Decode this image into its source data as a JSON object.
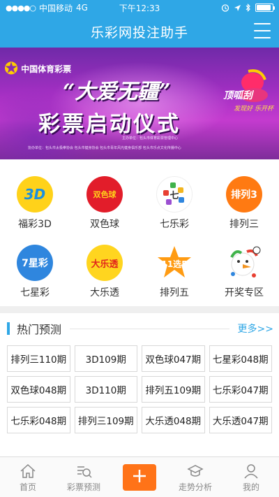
{
  "status_bar": {
    "carrier": "中国移动",
    "network": "4G",
    "time": "下午12:33",
    "battery_level": 0.9
  },
  "header": {
    "title": "乐彩网投注助手"
  },
  "banner": {
    "logo_text": "中国体育彩票",
    "slogan": "“大爱无疆”",
    "headline": "彩票启动仪式",
    "badge_text": "顶呱刮",
    "badge_sub": "发现好  乐开杯",
    "fine_print_1": "主办单位：包头市体育彩票管理中心",
    "fine_print_2": "协办单位：包头市太极拳协会    包头市健身协会    包头市青年风光健身俱乐部    包头市乐点文化传播中心"
  },
  "categories": [
    {
      "label": "福彩3D",
      "icon": "fucai-3d-icon",
      "badge": "3D",
      "color": "#ffd21a"
    },
    {
      "label": "双色球",
      "icon": "shuangseqiu-icon",
      "badge": "双色球",
      "color": "#e21d2a"
    },
    {
      "label": "七乐彩",
      "icon": "qilecai-icon",
      "badge": "七",
      "color": "#ffffff"
    },
    {
      "label": "排列三",
      "icon": "pailie3-icon",
      "badge": "排列3",
      "color": "#ff7a12"
    },
    {
      "label": "七星彩",
      "icon": "qixingcai-icon",
      "badge": "7星彩",
      "color": "#2f86de"
    },
    {
      "label": "大乐透",
      "icon": "daletou-icon",
      "badge": "大乐透",
      "color": "#ffd51f"
    },
    {
      "label": "排列五",
      "icon": "pailie5-icon",
      "badge": "11选5",
      "color": "#ff9b12"
    },
    {
      "label": "开奖专区",
      "icon": "kaijiang-icon",
      "badge": "",
      "color": "#ffffff"
    }
  ],
  "hot": {
    "title": "热门预测",
    "more": "更多>>",
    "items": [
      "排列三110期",
      "3D109期",
      "双色球047期",
      "七星彩048期",
      "双色球048期",
      "3D110期",
      "排列五109期",
      "七乐彩047期",
      "七乐彩048期",
      "排列三109期",
      "大乐透048期",
      "大乐透047期"
    ]
  },
  "nav": {
    "items": [
      {
        "label": "首页",
        "icon": "home-icon"
      },
      {
        "label": "彩票预测",
        "icon": "forecast-icon"
      },
      {
        "label": "",
        "icon": "plus-icon"
      },
      {
        "label": "走势分析",
        "icon": "trend-icon"
      },
      {
        "label": "我的",
        "icon": "profile-icon"
      }
    ]
  },
  "colors": {
    "primary": "#2fa7e6",
    "accent": "#ff7318"
  }
}
